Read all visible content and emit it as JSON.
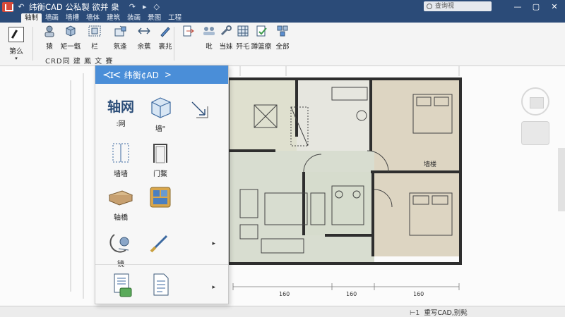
{
  "window": {
    "title": "纬衡CAD 公私製 欲并 衆",
    "quick_access": [
      "↶",
      "↷",
      "▸",
      "◇"
    ],
    "search_placeholder": "查询视",
    "controls": [
      "—",
      "▢",
      "✕"
    ]
  },
  "ribbon": {
    "tabs": [
      "轴制",
      "墙画",
      "墙槽",
      "墙体",
      "建筑",
      "装画",
      "景图",
      "工程"
    ],
    "active_tab": 0,
    "big_button": {
      "label": "第么"
    },
    "buttons": [
      {
        "label": "猿",
        "icon": "user-icon"
      },
      {
        "label": "矩一甑",
        "icon": "cube-icon"
      },
      {
        "label": "栏",
        "icon": "frame-icon"
      },
      {
        "label": "氛逢",
        "icon": "house-icon"
      },
      {
        "label": "余蕉",
        "icon": "double-arrow-icon"
      },
      {
        "label": "裹兆",
        "icon": "pen-icon"
      },
      {
        "label": "",
        "icon": "doc-arrow-icon"
      },
      {
        "label": "吡",
        "icon": "people-icon"
      },
      {
        "label": "当妹",
        "icon": "wrench-icon"
      },
      {
        "label": "歼乇",
        "icon": "grid-icon"
      },
      {
        "label": "蹲篮瘵",
        "icon": "check-doc-icon"
      },
      {
        "label": "全部",
        "icon": "gear-icon"
      }
    ],
    "panel_title": "CRD同 建 鳳 文 賽"
  },
  "popup": {
    "title": "纬衡¢AD",
    "logo": "≺ɪ<",
    "arrow": ">",
    "items": [
      {
        "label": ":网",
        "icon": "grid-text-icon",
        "glyph": "轴网"
      },
      {
        "label": "墙\"",
        "icon": "wall-cube-icon"
      },
      {
        "label": "",
        "icon": "corner-arrow-icon"
      },
      {
        "label": "墙墙",
        "icon": "wall-frame-icon"
      },
      {
        "label": "门鰲",
        "icon": "door-icon"
      },
      {
        "label": "轴橋",
        "icon": "table-icon"
      },
      {
        "label": "",
        "icon": "window-icon"
      },
      {
        "label": "镜",
        "icon": "person-icon"
      },
      {
        "label": "",
        "icon": "brush-icon"
      },
      {
        "label": "",
        "icon": "doc-stamp-icon"
      },
      {
        "label": "",
        "icon": "doc-icon"
      }
    ],
    "more": [
      "▸",
      "▸"
    ]
  },
  "drawing": {
    "room_label": "墙楼",
    "dims": [
      "160",
      "160",
      "160"
    ]
  },
  "status": {
    "model_tab": "重写CAD,别髡"
  },
  "colors": {
    "title_bar": "#2b4b78",
    "accent": "#4a8ed8",
    "room_green": "#d8ddd0",
    "room_tan": "#dcd4c2"
  }
}
